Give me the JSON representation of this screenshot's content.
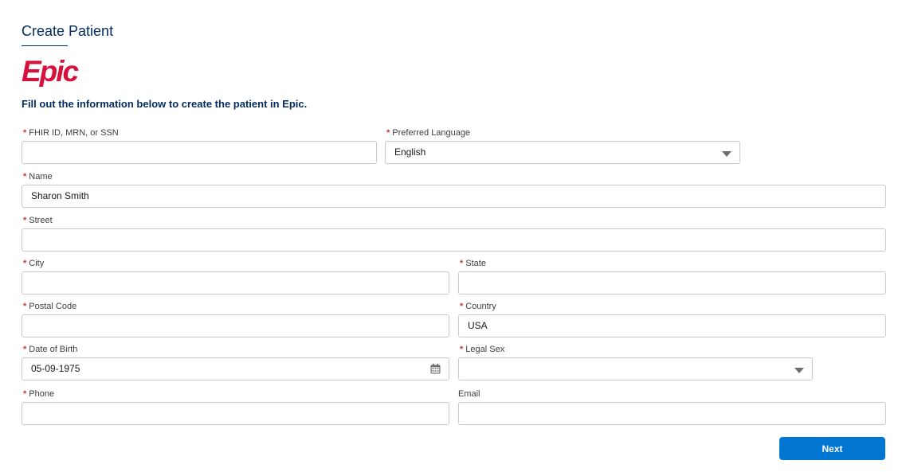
{
  "page": {
    "title": "Create Patient",
    "logo_text": "Epic",
    "intro": "Fill out the information below to create the patient in Epic."
  },
  "colors": {
    "title": "#032d60",
    "logo": "#d6113c",
    "required": "#c23934",
    "button": "#0176d3"
  },
  "form": {
    "required_marker": "*",
    "fhir_id": {
      "label": "FHIR ID, MRN, or SSN",
      "value": ""
    },
    "preferred_language": {
      "label": "Preferred Language",
      "value": "English"
    },
    "name": {
      "label": "Name",
      "value": "Sharon Smith"
    },
    "street": {
      "label": "Street",
      "value": ""
    },
    "city": {
      "label": "City",
      "value": ""
    },
    "state": {
      "label": "State",
      "value": ""
    },
    "postal_code": {
      "label": "Postal Code",
      "value": ""
    },
    "country": {
      "label": "Country",
      "value": "USA"
    },
    "date_of_birth": {
      "label": "Date of Birth",
      "value": "05-09-1975",
      "icon": "calendar-icon"
    },
    "legal_sex": {
      "label": "Legal Sex",
      "value": ""
    },
    "phone": {
      "label": "Phone",
      "value": ""
    },
    "email": {
      "label": "Email",
      "value": ""
    }
  },
  "actions": {
    "next_label": "Next"
  }
}
